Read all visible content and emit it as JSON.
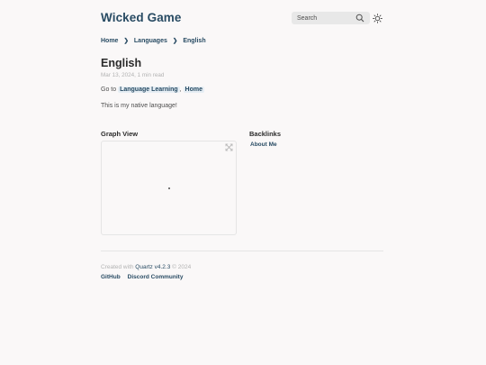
{
  "site": {
    "title": "Wicked Game"
  },
  "search": {
    "label": "Search"
  },
  "breadcrumb": {
    "items": [
      "Home",
      "Languages",
      "English"
    ],
    "separator": "❯"
  },
  "article": {
    "title": "English",
    "date": "Mar 13, 2024",
    "reading_time": "1 min read",
    "line1_prefix": "Go to ",
    "link_language_learning": "Language Learning",
    "link_separator": ", ",
    "link_home": "Home",
    "line2": "This is my native language!"
  },
  "graph": {
    "heading": "Graph View"
  },
  "backlinks": {
    "heading": "Backlinks",
    "items": [
      "About Me"
    ]
  },
  "footer": {
    "created_prefix": "Created with ",
    "quartz_link": "Quartz v4.2.3",
    "year": " © 2024",
    "links": [
      "GitHub",
      "Discord Community"
    ]
  },
  "colors": {
    "accent": "#284b63",
    "text": "#4e4e4e",
    "muted": "#b3b3b3",
    "background": "#faf8f8"
  }
}
